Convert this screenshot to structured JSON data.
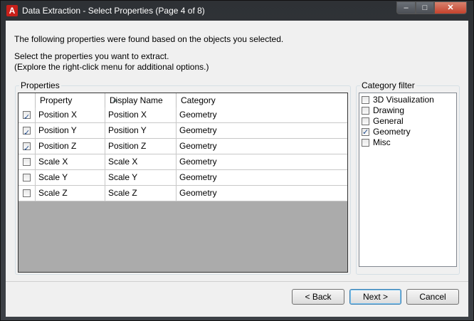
{
  "window": {
    "title": "Data Extraction - Select Properties (Page 4 of 8)",
    "icon_letter": "A",
    "min_glyph": "–",
    "max_glyph": "□",
    "close_glyph": "✕"
  },
  "intro_text": "The following properties were found based on the objects you selected.",
  "instructions": [
    "Select the properties you want to extract.",
    "(Explore the right-click menu for additional options.)"
  ],
  "properties": {
    "group_label": "Properties",
    "columns": [
      "Property",
      "Display Name",
      "Category"
    ],
    "rows": [
      {
        "checked": true,
        "property": "Position X",
        "display_name": "Position X",
        "category": "Geometry"
      },
      {
        "checked": true,
        "property": "Position Y",
        "display_name": "Position Y",
        "category": "Geometry"
      },
      {
        "checked": true,
        "property": "Position Z",
        "display_name": "Position Z",
        "category": "Geometry"
      },
      {
        "checked": false,
        "property": "Scale X",
        "display_name": "Scale X",
        "category": "Geometry"
      },
      {
        "checked": false,
        "property": "Scale Y",
        "display_name": "Scale Y",
        "category": "Geometry"
      },
      {
        "checked": false,
        "property": "Scale Z",
        "display_name": "Scale Z",
        "category": "Geometry"
      }
    ]
  },
  "category_filter": {
    "group_label": "Category filter",
    "items": [
      {
        "label": "3D Visualization",
        "checked": false
      },
      {
        "label": "Drawing",
        "checked": false
      },
      {
        "label": "General",
        "checked": false
      },
      {
        "label": "Geometry",
        "checked": true
      },
      {
        "label": "Misc",
        "checked": false
      }
    ]
  },
  "buttons": {
    "back": "< Back",
    "next": "Next >",
    "cancel": "Cancel"
  },
  "colors": {
    "accent_red": "#c8201a",
    "grid_empty_area": "#ababab",
    "default_button_border": "#3c7fb1"
  }
}
